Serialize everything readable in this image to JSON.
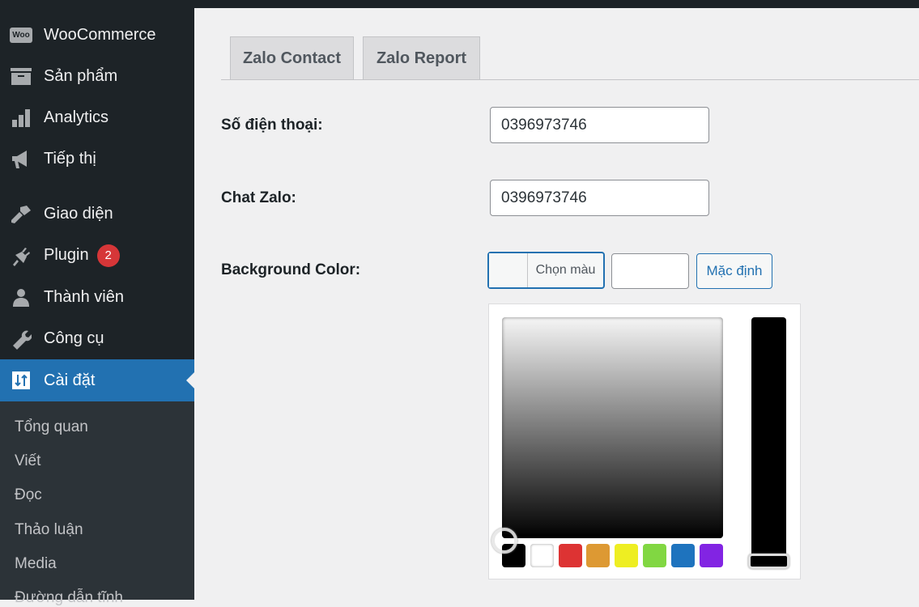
{
  "sidebar": {
    "items": [
      {
        "label": "WooCommerce",
        "icon": "woo-icon"
      },
      {
        "label": "Sản phẩm",
        "icon": "archive-icon"
      },
      {
        "label": "Analytics",
        "icon": "bar-chart-icon"
      },
      {
        "label": "Tiếp thị",
        "icon": "megaphone-icon"
      },
      {
        "label": "Giao diện",
        "icon": "paintbrush-icon"
      },
      {
        "label": "Plugin",
        "icon": "plugin-icon",
        "badge": "2"
      },
      {
        "label": "Thành viên",
        "icon": "user-icon"
      },
      {
        "label": "Công cụ",
        "icon": "wrench-icon"
      },
      {
        "label": "Cài đặt",
        "icon": "settings-icon",
        "active": true
      }
    ],
    "submenu": [
      "Tổng quan",
      "Viết",
      "Đọc",
      "Thảo luận",
      "Media",
      "Đường dẫn tĩnh"
    ],
    "woo_logo": "Woo"
  },
  "tabs": [
    "Zalo Contact",
    "Zalo Report"
  ],
  "form": {
    "phone_label": "Số điện thoại:",
    "phone_value": "0396973746",
    "zalo_label": "Chat Zalo:",
    "zalo_value": "0396973746",
    "bg_label": "Background Color:",
    "pick_label": "Chọn màu",
    "default_label": "Mặc định",
    "hex_value": ""
  },
  "palette": [
    "#000000",
    "#ffffff",
    "#dd3333",
    "#dd9933",
    "#eeee22",
    "#81d742",
    "#1e73be",
    "#8224e3"
  ]
}
